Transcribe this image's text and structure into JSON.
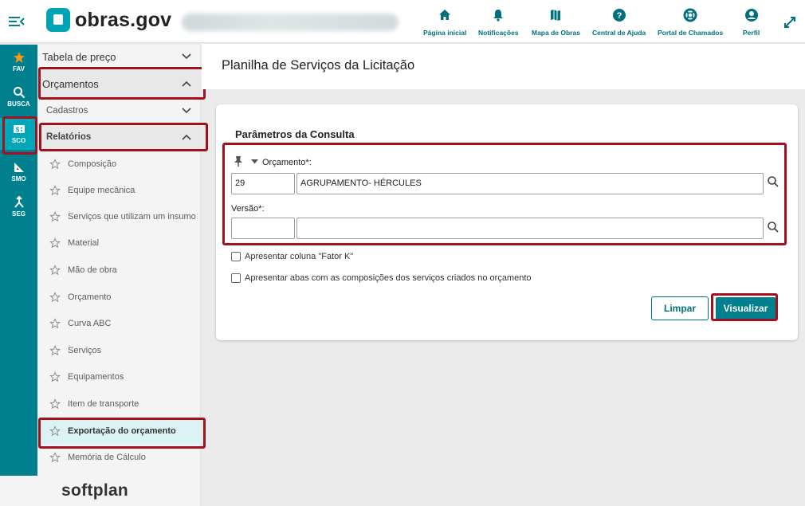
{
  "header": {
    "logo_text": "obras.gov",
    "nav": [
      {
        "label": "Página inicial",
        "icon": "home-icon"
      },
      {
        "label": "Notificações",
        "icon": "bell-icon"
      },
      {
        "label": "Mapa de Obras",
        "icon": "map-icon"
      },
      {
        "label": "Central de Ajuda",
        "icon": "help-icon"
      },
      {
        "label": "Portal de Chamados",
        "icon": "lifebuoy-icon"
      },
      {
        "label": "Perfil",
        "icon": "user-icon"
      }
    ]
  },
  "rail": {
    "items": [
      {
        "label": "FAV",
        "icon": "star-icon"
      },
      {
        "label": "BUSCA",
        "icon": "search-icon"
      },
      {
        "label": "SCO",
        "icon": "money-icon"
      },
      {
        "label": "SMO",
        "icon": "ruler-icon"
      },
      {
        "label": "SEG",
        "icon": "merge-icon"
      }
    ]
  },
  "sidemenu": {
    "tabela": "Tabela de preço",
    "orcamentos": "Orçamentos",
    "cadastros": "Cadastros",
    "relatorios": "Relatórios",
    "items": [
      {
        "label": "Composição"
      },
      {
        "label": "Equipe mecânica"
      },
      {
        "label": "Serviços que utilizam um insumo"
      },
      {
        "label": "Material"
      },
      {
        "label": "Mão de obra"
      },
      {
        "label": "Orçamento"
      },
      {
        "label": "Curva ABC"
      },
      {
        "label": "Serviços"
      },
      {
        "label": "Equipamentos"
      },
      {
        "label": "Item de transporte"
      },
      {
        "label": "Exportação do orçamento"
      },
      {
        "label": "Memória de Cálculo"
      }
    ],
    "footer_brand": "softplan"
  },
  "page": {
    "title": "Planilha de Serviços da Licitação",
    "card_title": "Parâmetros da Consulta",
    "orcamento_label": "Orçamento*:",
    "orcamento_code": "29",
    "orcamento_desc": "AGRUPAMENTO- HÉRCULES",
    "versao_label": "Versão*:",
    "versao_code": "",
    "versao_desc": "",
    "check_fator_k": "Apresentar coluna \"Fator K\"",
    "check_abas": "Apresentar abas com as composições dos serviços criados no orçamento",
    "btn_limpar": "Limpar",
    "btn_visualizar": "Visualizar"
  },
  "colors": {
    "teal": "#007f8e",
    "accent": "#00a3b4",
    "highlight": "#a3101e",
    "star": "#f39c12"
  }
}
